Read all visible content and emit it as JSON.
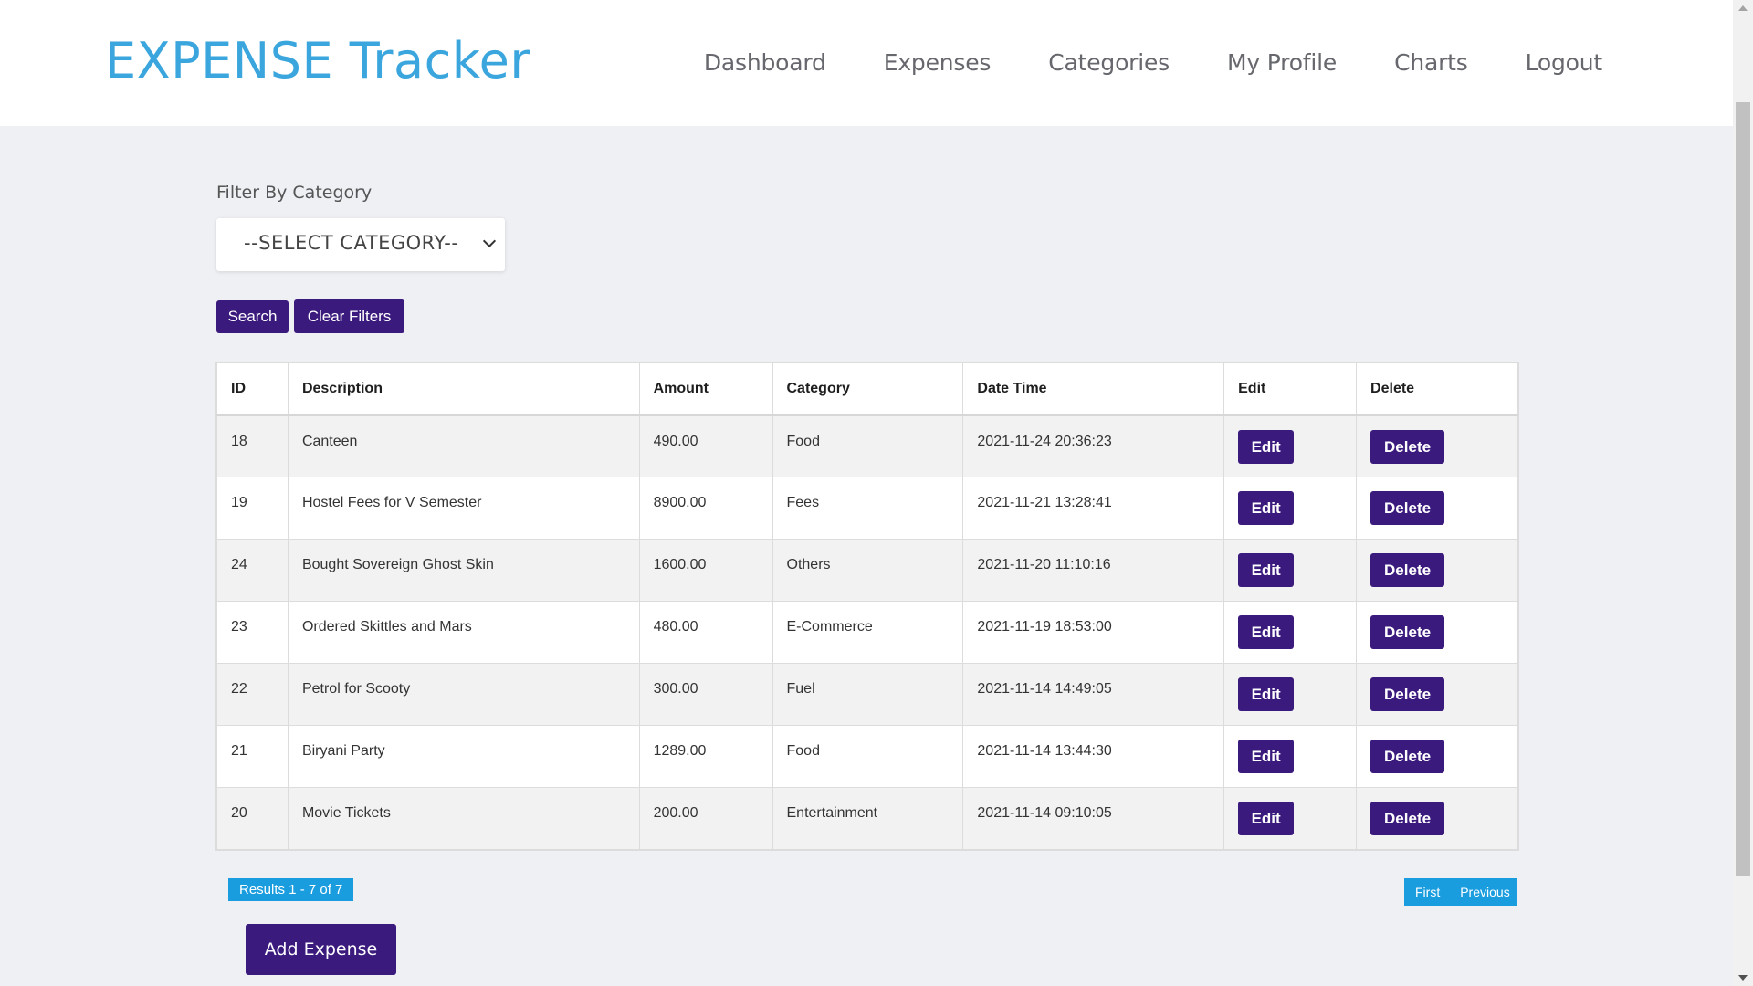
{
  "header": {
    "brand": "EXPENSE Tracker",
    "nav": [
      "Dashboard",
      "Expenses",
      "Categories",
      "My Profile",
      "Charts",
      "Logout"
    ]
  },
  "filter": {
    "label": "Filter By Category",
    "select_value": "--SELECT CATEGORY--",
    "search_label": "Search",
    "clear_label": "Clear Filters"
  },
  "table": {
    "columns": [
      "ID",
      "Description",
      "Amount",
      "Category",
      "Date Time",
      "Edit",
      "Delete"
    ],
    "rows": [
      {
        "id": "18",
        "description": "Canteen",
        "amount": "490.00",
        "category": "Food",
        "datetime": "2021-11-24 20:36:23"
      },
      {
        "id": "19",
        "description": "Hostel Fees for V Semester",
        "amount": "8900.00",
        "category": "Fees",
        "datetime": "2021-11-21 13:28:41"
      },
      {
        "id": "24",
        "description": "Bought Sovereign Ghost Skin",
        "amount": "1600.00",
        "category": "Others",
        "datetime": "2021-11-20 11:10:16"
      },
      {
        "id": "23",
        "description": "Ordered Skittles and Mars",
        "amount": "480.00",
        "category": "E-Commerce",
        "datetime": "2021-11-19 18:53:00"
      },
      {
        "id": "22",
        "description": "Petrol for Scooty",
        "amount": "300.00",
        "category": "Fuel",
        "datetime": "2021-11-14 14:49:05"
      },
      {
        "id": "21",
        "description": "Biryani Party",
        "amount": "1289.00",
        "category": "Food",
        "datetime": "2021-11-14 13:44:30"
      },
      {
        "id": "20",
        "description": "Movie Tickets",
        "amount": "200.00",
        "category": "Entertainment",
        "datetime": "2021-11-14 09:10:05"
      }
    ],
    "edit_label": "Edit",
    "delete_label": "Delete"
  },
  "pagination": {
    "results_text": "Results 1 - 7 of 7",
    "first_label": "First",
    "previous_label": "Previous"
  },
  "add_button_label": "Add Expense",
  "colors": {
    "brand": "#3aa6dd",
    "button": "#3b1a7e",
    "badge": "#1a9ddf",
    "page_bg": "#eff0f4"
  }
}
